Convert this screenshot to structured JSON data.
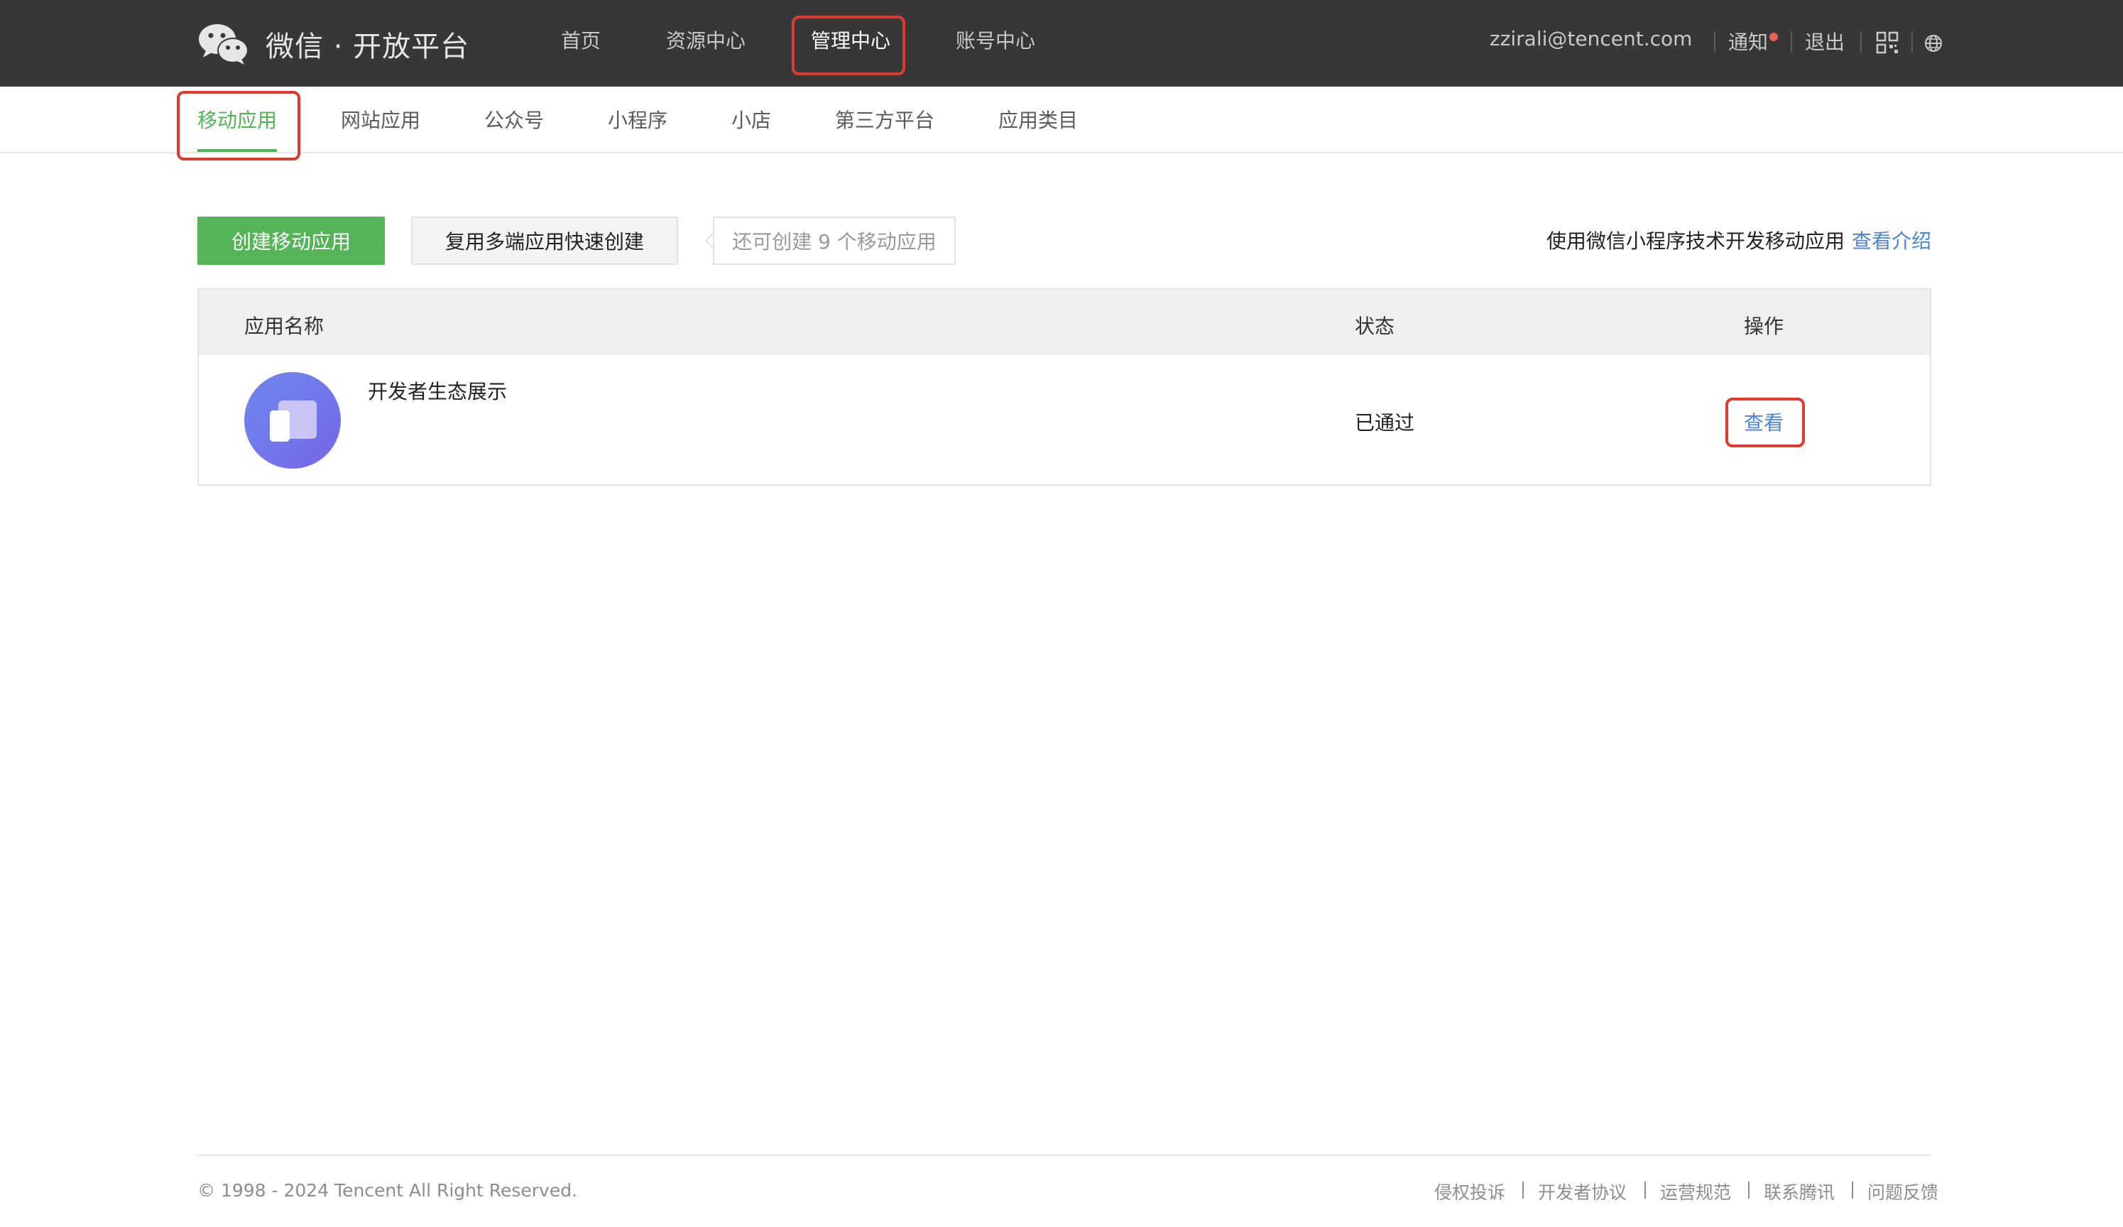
{
  "header": {
    "brand": "微信 · 开放平台",
    "nav": [
      {
        "label": "首页"
      },
      {
        "label": "资源中心"
      },
      {
        "label": "管理中心"
      },
      {
        "label": "账号中心"
      }
    ],
    "user_email": "zzirali@tencent.com",
    "notify_label": "通知",
    "logout_label": "退出"
  },
  "subnav": {
    "items": [
      {
        "label": "移动应用"
      },
      {
        "label": "网站应用"
      },
      {
        "label": "公众号"
      },
      {
        "label": "小程序"
      },
      {
        "label": "小店"
      },
      {
        "label": "第三方平台"
      },
      {
        "label": "应用类目"
      }
    ]
  },
  "toolbar": {
    "create_label": "创建移动应用",
    "reuse_label": "复用多端应用快速创建",
    "remaining_tip": "还可创建 9 个移动应用",
    "intro_text": "使用微信小程序技术开发移动应用",
    "intro_link": "查看介绍"
  },
  "table": {
    "headers": [
      "应用名称",
      "状态",
      "操作"
    ],
    "rows": [
      {
        "name": "开发者生态展示",
        "status": "已通过",
        "action": "查看"
      }
    ]
  },
  "footer": {
    "copyright": "© 1998 - 2024 Tencent All Right Reserved.",
    "links": [
      "侵权投诉",
      "开发者协议",
      "运营规范",
      "联系腾讯",
      "问题反馈"
    ]
  },
  "colors": {
    "accent_green": "#56b458",
    "link_blue": "#4a86d8",
    "highlight_red": "#e03a2f",
    "topbar": "#373737"
  }
}
